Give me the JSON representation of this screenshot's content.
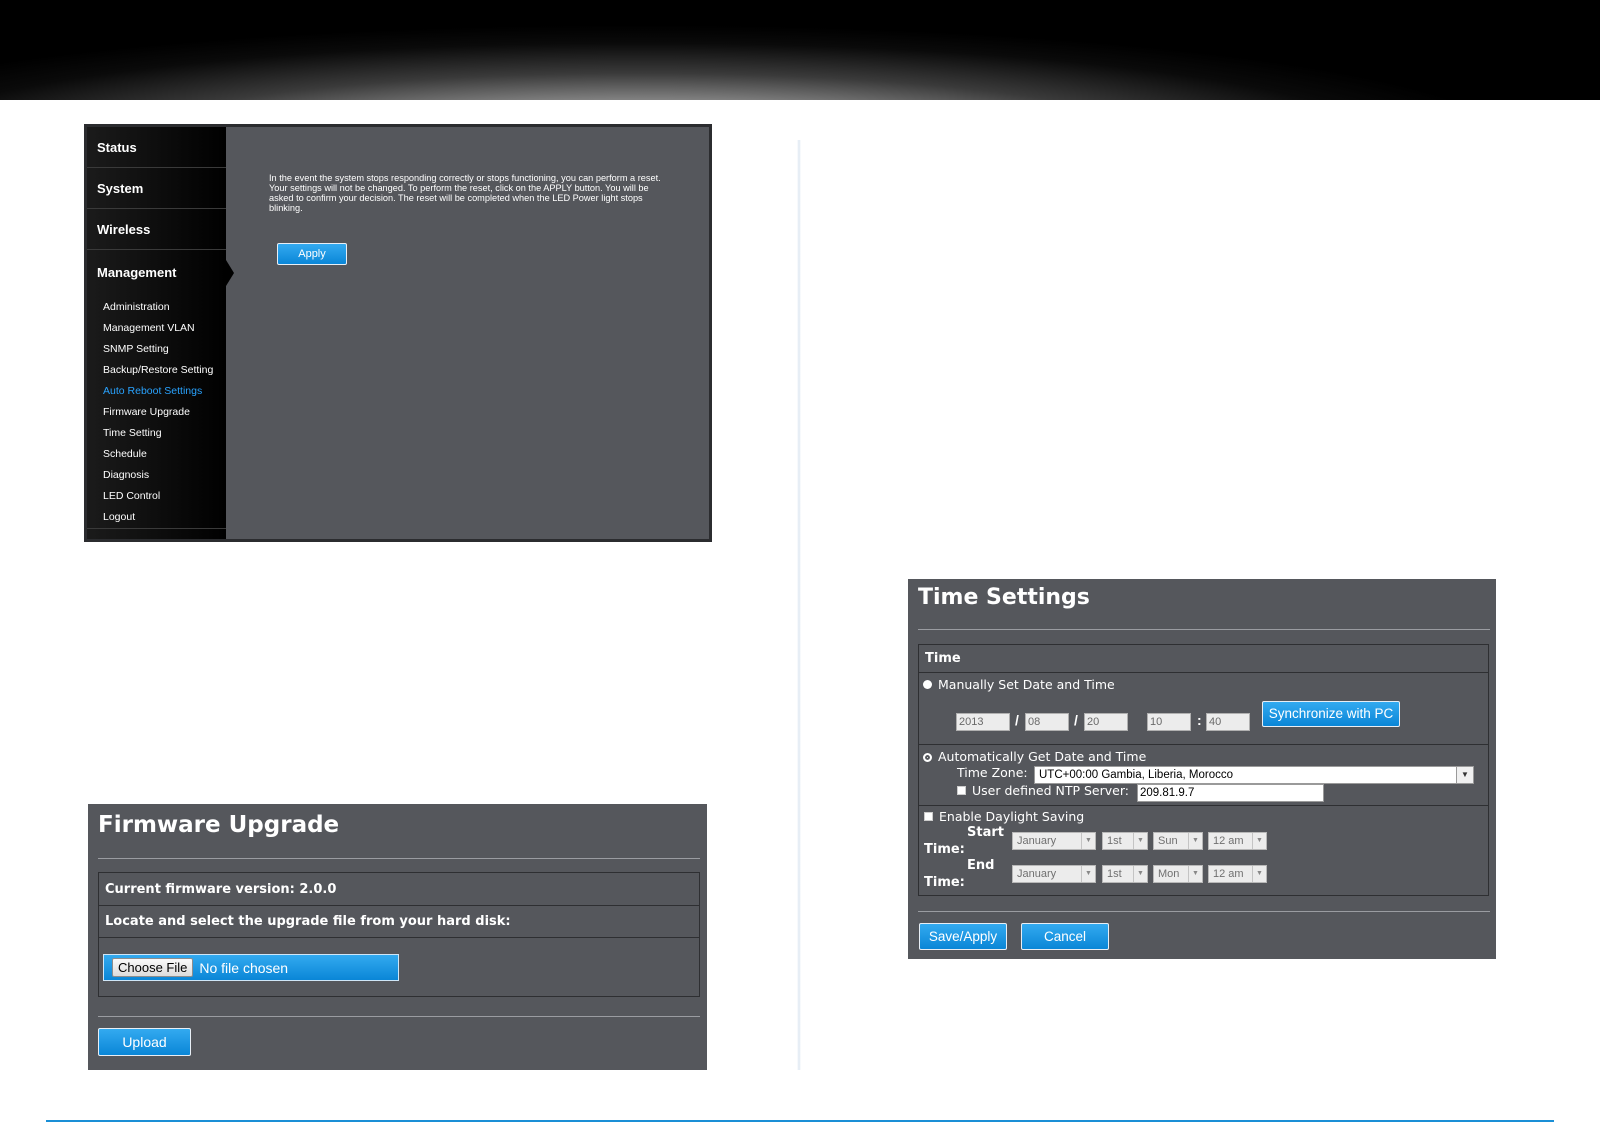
{
  "colors": {
    "accent": "#1a8fd6",
    "panel_bg": "#55575c",
    "nav_bg": "#000000",
    "nav_current": "#29a3ff"
  },
  "reboot_panel": {
    "nav_main": [
      "Status",
      "System",
      "Wireless",
      "Management"
    ],
    "nav_sub": [
      "Administration",
      "Management VLAN",
      "SNMP Setting",
      "Backup/Restore Setting",
      "Auto Reboot Settings",
      "Firmware Upgrade",
      "Time Setting",
      "Schedule",
      "Diagnosis",
      "LED Control",
      "Logout"
    ],
    "current_sub": "Auto Reboot Settings",
    "description": "In the event the system stops responding correctly or stops functioning, you can perform a reset. Your settings will not be changed. To perform the reset, click on the APPLY button. You will be asked to confirm your decision. The reset will be completed when the LED Power light stops blinking.",
    "apply_label": "Apply"
  },
  "firmware_panel": {
    "title": "Firmware Upgrade",
    "current_version": "Current firmware version: 2.0.0",
    "locate_label": "Locate and select the upgrade file from your hard disk:",
    "choose_file_label": "Choose File",
    "no_file_label": "No file chosen",
    "upload_label": "Upload"
  },
  "time_panel": {
    "title": "Time Settings",
    "section_time": "Time",
    "manual_label": "Manually Set Date and Time",
    "year": "2013",
    "month": "08",
    "day": "20",
    "hour": "10",
    "minute": "40",
    "date_sep": "/",
    "time_sep": ":",
    "sync_label": "Synchronize with PC",
    "auto_label": "Automatically Get Date and Time",
    "timezone_label": "Time Zone:",
    "timezone_value": "UTC+00:00 Gambia, Liberia, Morocco",
    "ntp_label": "User defined NTP Server:",
    "ntp_value": "209.81.9.7",
    "dst_label": "Enable Daylight Saving",
    "start_label_1": "Start",
    "start_label_2": "Time:",
    "end_label_1": "End",
    "end_label_2": "Time:",
    "start": {
      "month": "January",
      "week": "1st",
      "day": "Sun",
      "hour": "12 am"
    },
    "end": {
      "month": "January",
      "week": "1st",
      "day": "Mon",
      "hour": "12 am"
    },
    "save_label": "Save/Apply",
    "cancel_label": "Cancel"
  }
}
